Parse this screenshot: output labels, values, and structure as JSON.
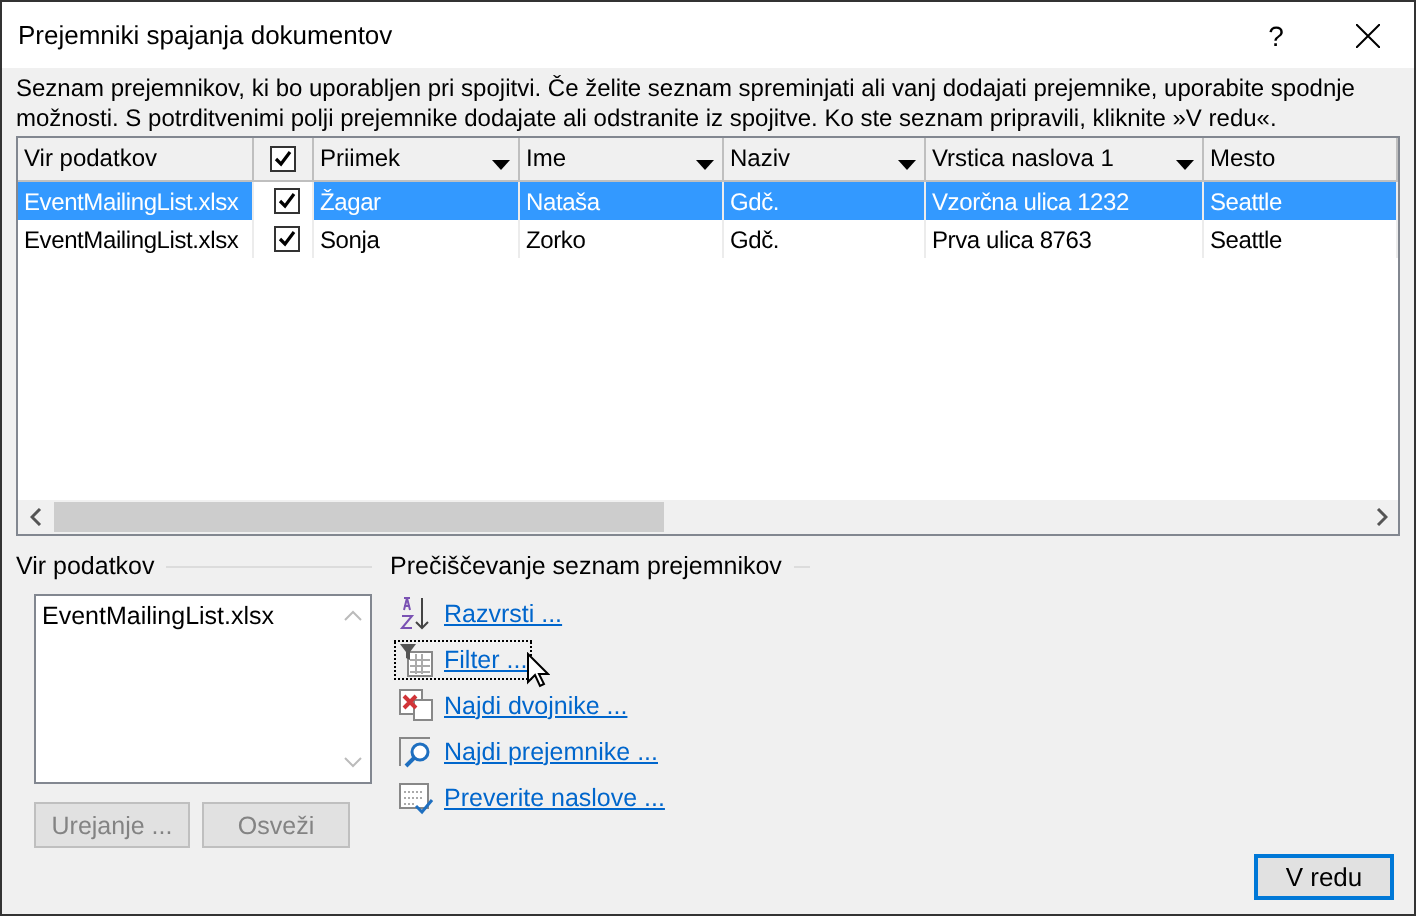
{
  "window": {
    "title": "Prejemniki spajanja dokumentov",
    "help": "?"
  },
  "description": "Seznam prejemnikov, ki bo uporabljen pri spojitvi. Če želite seznam spreminjati ali vanj dodajati prejemnike, uporabite spodnje možnosti. S potrditvenimi polji prejemnike dodajate ali odstranite iz spojitve. Ko ste seznam pripravili, kliknite »V redu«.",
  "table": {
    "columns": [
      {
        "kind": "text",
        "label": "Vir podatkov",
        "dropdown": false
      },
      {
        "kind": "check",
        "checked": true
      },
      {
        "kind": "text",
        "label": "Priimek",
        "dropdown": true
      },
      {
        "kind": "text",
        "label": "Ime",
        "dropdown": true
      },
      {
        "kind": "text",
        "label": "Naziv",
        "dropdown": true
      },
      {
        "kind": "text",
        "label": "Vrstica naslova 1",
        "dropdown": true
      },
      {
        "kind": "text",
        "label": "Mesto",
        "dropdown": false
      }
    ],
    "rows": [
      {
        "selected": true,
        "checked": true,
        "cells": [
          "EventMailingList.xlsx",
          "",
          "Žagar",
          "Nataša",
          "Gdč.",
          "Vzorčna ulica 1232",
          "Seattle"
        ]
      },
      {
        "selected": false,
        "checked": true,
        "cells": [
          "EventMailingList.xlsx",
          "",
          "Sonja",
          "Zorko",
          "Gdč.",
          "Prva ulica 8763",
          "Seattle"
        ]
      }
    ]
  },
  "data_sources": {
    "label": "Vir podatkov",
    "items": [
      "EventMailingList.xlsx"
    ],
    "buttons": [
      {
        "label": "Urejanje ...",
        "disabled": true
      },
      {
        "label": "Osveži",
        "disabled": true
      }
    ]
  },
  "refine": {
    "label": "Prečiščevanje seznam prejemnikov",
    "links": [
      {
        "kind": "sort",
        "label": "Razvrsti ...",
        "focused": false
      },
      {
        "kind": "filter",
        "label": "Filter ...",
        "focused": true
      },
      {
        "kind": "duplicates",
        "label": "Najdi dvojnike ...",
        "focused": false
      },
      {
        "kind": "find",
        "label": "Najdi prejemnike ...",
        "focused": false
      },
      {
        "kind": "validate",
        "label": "Preverite naslove ...",
        "focused": false
      }
    ]
  },
  "ok_button": "V redu"
}
